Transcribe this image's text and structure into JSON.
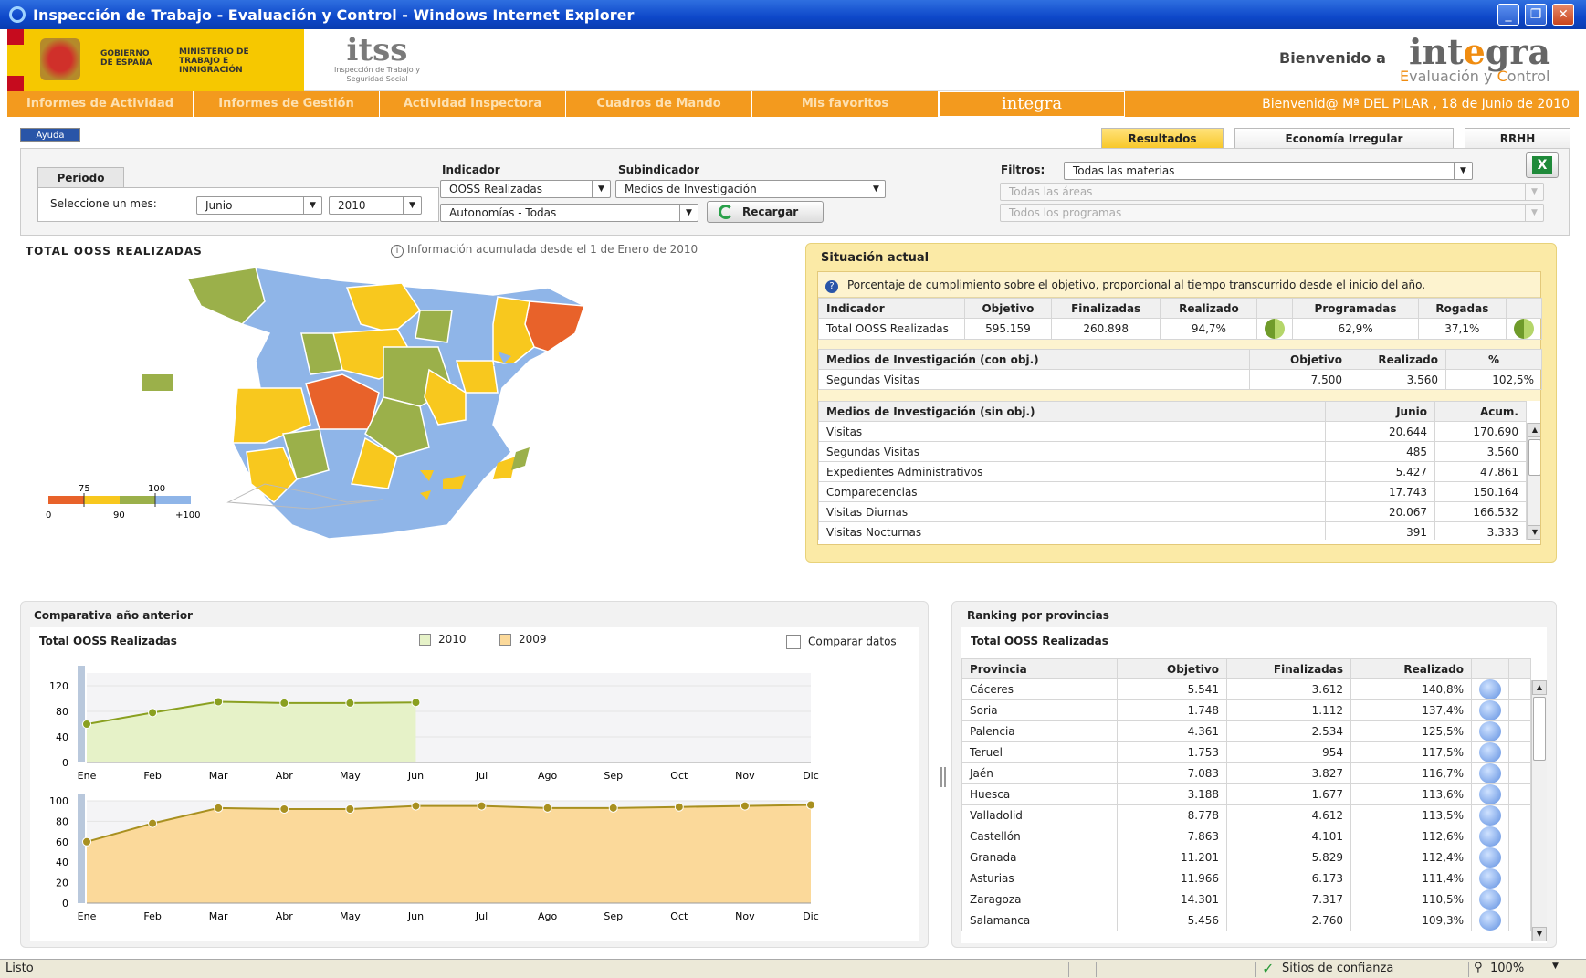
{
  "window": {
    "title": "Inspección de Trabajo - Evaluación y Control - Windows Internet Explorer",
    "controls": [
      "_",
      "❐",
      "✕"
    ]
  },
  "header": {
    "gobierno": "GOBIERNO DE ESPAÑA",
    "ministerio": "MINISTERIO DE TRABAJO E INMIGRACIÓN",
    "itss_logo": "itss",
    "itss_caption": "Inspección de Trabajo y Seguridad Social",
    "welcome": "Bienvenido a",
    "brand_pre": "int",
    "brand_mid": "e",
    "brand_post": "gra",
    "brand_sub_E": "E",
    "brand_sub_1": "valuación y ",
    "brand_sub_C": "C",
    "brand_sub_2": "ontrol"
  },
  "nav": {
    "items": [
      "Informes de Actividad",
      "Informes de Gestión",
      "Actividad Inspectora",
      "Cuadros de Mando",
      "Mis favoritos"
    ],
    "brand": "integra",
    "user_greeting": "Bienvenid@ Mª DEL PILAR , 18 de Junio de 2010"
  },
  "help": {
    "label": "Ayuda"
  },
  "tabs": [
    "Resultados",
    "Economía Irregular",
    "RRHH"
  ],
  "filters": {
    "periodo_label": "Periodo",
    "mes_label": "Seleccione un mes:",
    "mes_value": "Junio",
    "anio_value": "2010",
    "indicador_label": "Indicador",
    "indicador_value": "OOSS Realizadas",
    "subindicador_label": "Subindicador",
    "subindicador_value": "Medios de Investigación",
    "autonomias_value": "Autonomías - Todas",
    "recargar_label": "Recargar",
    "filtros_label": "Filtros:",
    "materias_value": "Todas las materias",
    "areas_placeholder": "Todas las áreas",
    "programas_placeholder": "Todos los programas",
    "excel_icon": "excel-icon"
  },
  "map": {
    "title": "TOTAL OOSS REALIZADAS",
    "info": "Información acumulada desde el 1 de Enero de 2010",
    "legend_top": [
      "75",
      "100"
    ],
    "legend_bottom": [
      "0",
      "90",
      "+100"
    ],
    "colors": {
      "red": "#e8622a",
      "yellow": "#f8c81e",
      "green": "#9bb04a",
      "blue": "#8fb5e8"
    }
  },
  "situacion": {
    "title": "Situación actual",
    "note": "Porcentaje de cumplimiento sobre el objetivo, proporcional al tiempo transcurrido desde el inicio del año.",
    "headers": [
      "Indicador",
      "Objetivo",
      "Finalizadas",
      "Realizado",
      "",
      "Programadas",
      "Rogadas"
    ],
    "row": [
      "Total OOSS Realizadas",
      "595.159",
      "260.898",
      "94,7%",
      "62,9%",
      "37,1%"
    ],
    "con_obj_headers": [
      "Medios de Investigación (con obj.)",
      "Objetivo",
      "Realizado",
      "%"
    ],
    "con_obj_row": [
      "Segundas Visitas",
      "7.500",
      "3.560",
      "102,5%"
    ],
    "sin_obj_headers": [
      "Medios de Investigación (sin obj.)",
      "Junio",
      "Acum."
    ],
    "sin_obj_rows": [
      [
        "Visitas",
        "20.644",
        "170.690"
      ],
      [
        "Segundas Visitas",
        "485",
        "3.560"
      ],
      [
        "Expedientes Administrativos",
        "5.427",
        "47.861"
      ],
      [
        "Comparecencias",
        "17.743",
        "150.164"
      ],
      [
        "Visitas Diurnas",
        "20.067",
        "166.532"
      ],
      [
        "Visitas Nocturnas",
        "391",
        "3.333"
      ]
    ]
  },
  "comparativa": {
    "title": "Comparativa año anterior",
    "subtitle": "Total OOSS Realizadas",
    "legend": [
      "2010",
      "2009"
    ],
    "compare_label": "Comparar datos"
  },
  "chart_data": [
    {
      "type": "area",
      "series": [
        {
          "name": "2010",
          "values": [
            60,
            78,
            95,
            93,
            93,
            94
          ]
        }
      ],
      "categories": [
        "Ene",
        "Feb",
        "Mar",
        "Abr",
        "May",
        "Jun",
        "Jul",
        "Ago",
        "Sep",
        "Oct",
        "Nov",
        "Dic"
      ],
      "yticks": [
        "0",
        "40",
        "80",
        "120"
      ],
      "ylim": [
        0,
        140
      ],
      "color": "#e6f2c8",
      "line": "#8aa020"
    },
    {
      "type": "area",
      "series": [
        {
          "name": "2009",
          "values": [
            60,
            78,
            93,
            92,
            92,
            95,
            95,
            93,
            93,
            94,
            95,
            96
          ]
        }
      ],
      "categories": [
        "Ene",
        "Feb",
        "Mar",
        "Abr",
        "May",
        "Jun",
        "Jul",
        "Ago",
        "Sep",
        "Oct",
        "Nov",
        "Dic"
      ],
      "yticks": [
        "0",
        "20",
        "40",
        "60",
        "80",
        "100"
      ],
      "ylim": [
        0,
        100
      ],
      "color": "#fbd99a",
      "line": "#a89020"
    }
  ],
  "ranking": {
    "title": "Ranking por provincias",
    "subtitle": "Total OOSS Realizadas",
    "headers": [
      "Provincia",
      "Objetivo",
      "Finalizadas",
      "Realizado"
    ],
    "rows": [
      [
        "Cáceres",
        "5.541",
        "3.612",
        "140,8%"
      ],
      [
        "Soria",
        "1.748",
        "1.112",
        "137,4%"
      ],
      [
        "Palencia",
        "4.361",
        "2.534",
        "125,5%"
      ],
      [
        "Teruel",
        "1.753",
        "954",
        "117,5%"
      ],
      [
        "Jaén",
        "7.083",
        "3.827",
        "116,7%"
      ],
      [
        "Huesca",
        "3.188",
        "1.677",
        "113,6%"
      ],
      [
        "Valladolid",
        "8.778",
        "4.612",
        "113,5%"
      ],
      [
        "Castellón",
        "7.863",
        "4.101",
        "112,6%"
      ],
      [
        "Granada",
        "11.201",
        "5.829",
        "112,4%"
      ],
      [
        "Asturias",
        "11.966",
        "6.173",
        "111,4%"
      ],
      [
        "Zaragoza",
        "14.301",
        "7.317",
        "110,5%"
      ],
      [
        "Salamanca",
        "5.456",
        "2.760",
        "109,3%"
      ]
    ]
  },
  "statusbar": {
    "left": "Listo",
    "zone": "Sitios de confianza",
    "zoom": "100%"
  }
}
